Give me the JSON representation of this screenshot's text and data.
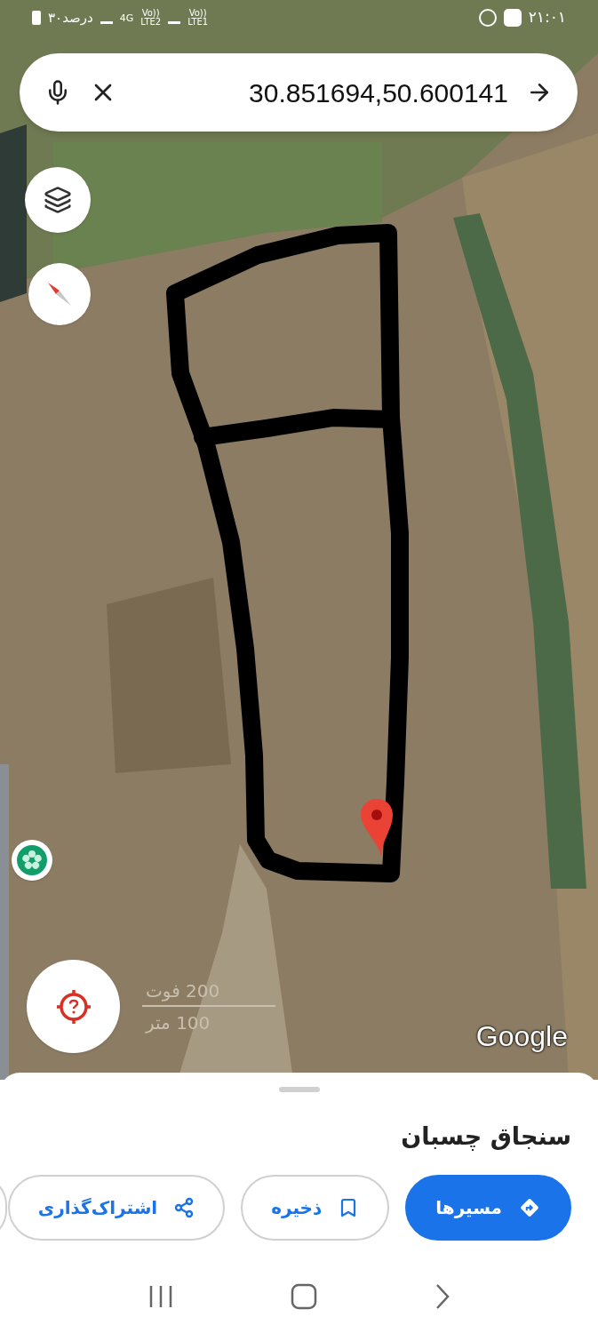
{
  "status_bar": {
    "time": "۲۱:۰۱",
    "battery": "۳۰درصد",
    "network": "4G",
    "sim_2_volte": "Vo))",
    "sim_2": "LTE2",
    "sim_1_volte": "Vo))",
    "sim_1": "LTE1"
  },
  "search": {
    "value": "30.851694,50.600141"
  },
  "map": {
    "scale_feet": "200 فوت",
    "scale_meters": "100 متر",
    "logo": "Google"
  },
  "place": {
    "title": "سنجاق چسبان"
  },
  "actions": [
    {
      "label": "مسیرها",
      "kind": "directions"
    },
    {
      "label": "ذخیره",
      "kind": "save"
    },
    {
      "label": "اشتراک‌گذاری",
      "kind": "share"
    }
  ]
}
